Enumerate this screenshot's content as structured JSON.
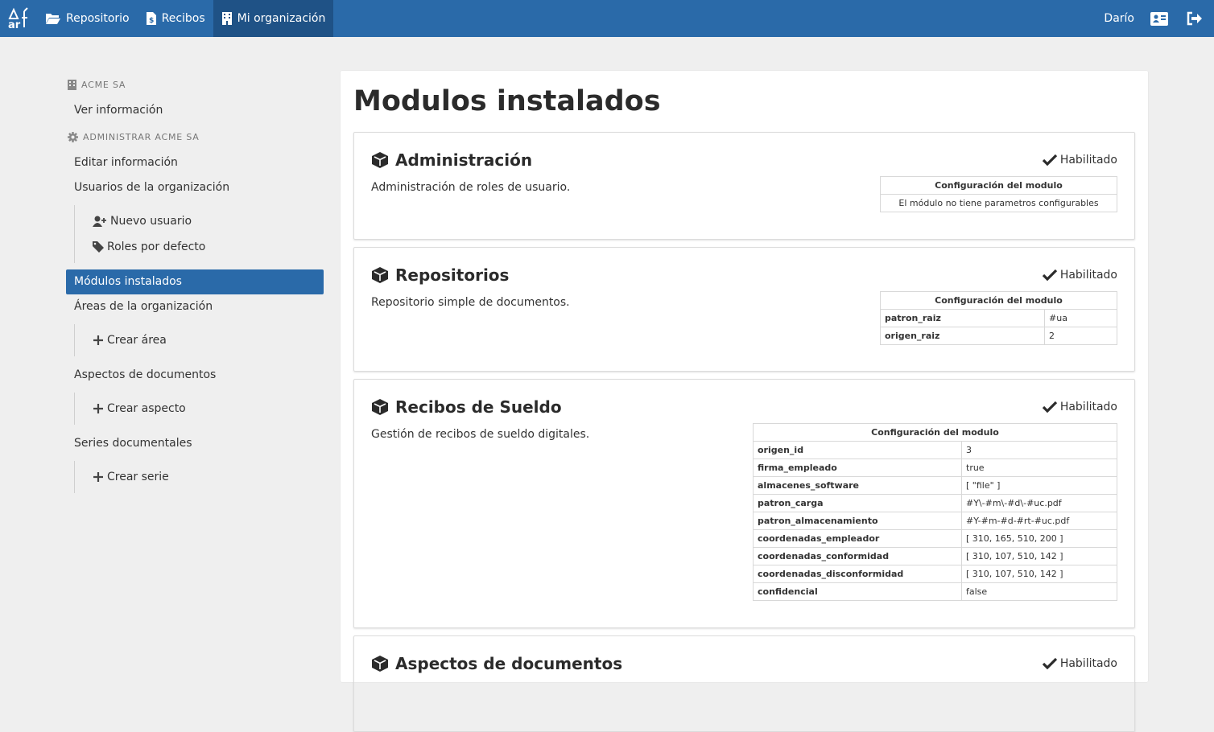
{
  "nav": {
    "items": [
      {
        "label": "Repositorio",
        "icon": "folder-open-icon"
      },
      {
        "label": "Recibos",
        "icon": "receipt-file-icon"
      },
      {
        "label": "Mi organización",
        "icon": "building-icon"
      }
    ],
    "user": "Darío"
  },
  "sidebar": {
    "org_header": "ACME SA",
    "ver_info": "Ver información",
    "admin_header": "ADMINISTRAR ACME SA",
    "editar_info": "Editar información",
    "usuarios": "Usuarios de la organización",
    "nuevo_usuario": "Nuevo usuario",
    "roles_defecto": "Roles por defecto",
    "modulos": "Módulos instalados",
    "areas": "Áreas de la organización",
    "crear_area": "Crear área",
    "aspectos": "Aspectos de documentos",
    "crear_aspecto": "Crear aspecto",
    "series": "Series documentales",
    "crear_serie": "Crear serie"
  },
  "main": {
    "title": "Modulos instalados",
    "config_header": "Configuración del modulo",
    "modules": [
      {
        "name": "Administración",
        "status": "Habilitado",
        "description": "Administración de roles de usuario.",
        "empty_msg": "El módulo no tiene parametros configurables"
      },
      {
        "name": "Repositorios",
        "status": "Habilitado",
        "description": "Repositorio simple de documentos.",
        "params": [
          {
            "k": "patron_raiz",
            "v": "#ua"
          },
          {
            "k": "origen_raiz",
            "v": "2"
          }
        ]
      },
      {
        "name": "Recibos de Sueldo",
        "status": "Habilitado",
        "description": "Gestión de recibos de sueldo digitales.",
        "params": [
          {
            "k": "origen_id",
            "v": "3"
          },
          {
            "k": "firma_empleado",
            "v": "true"
          },
          {
            "k": "almacenes_software",
            "v": "[ \"file\" ]"
          },
          {
            "k": "patron_carga",
            "v": "#Y\\-#m\\-#d\\-#uc.pdf"
          },
          {
            "k": "patron_almacenamiento",
            "v": "#Y-#m-#d-#rt-#uc.pdf"
          },
          {
            "k": "coordenadas_empleador",
            "v": "[ 310, 165, 510, 200 ]"
          },
          {
            "k": "coordenadas_conformidad",
            "v": "[ 310, 107, 510, 142 ]"
          },
          {
            "k": "coordenadas_disconformidad",
            "v": "[ 310, 107, 510, 142 ]"
          },
          {
            "k": "confidencial",
            "v": "false"
          }
        ]
      },
      {
        "name": "Aspectos de documentos",
        "status": "Habilitado"
      }
    ]
  },
  "colors": {
    "primary": "#2a6aa9",
    "primary_dark": "#1f5286",
    "background": "#efefef"
  }
}
